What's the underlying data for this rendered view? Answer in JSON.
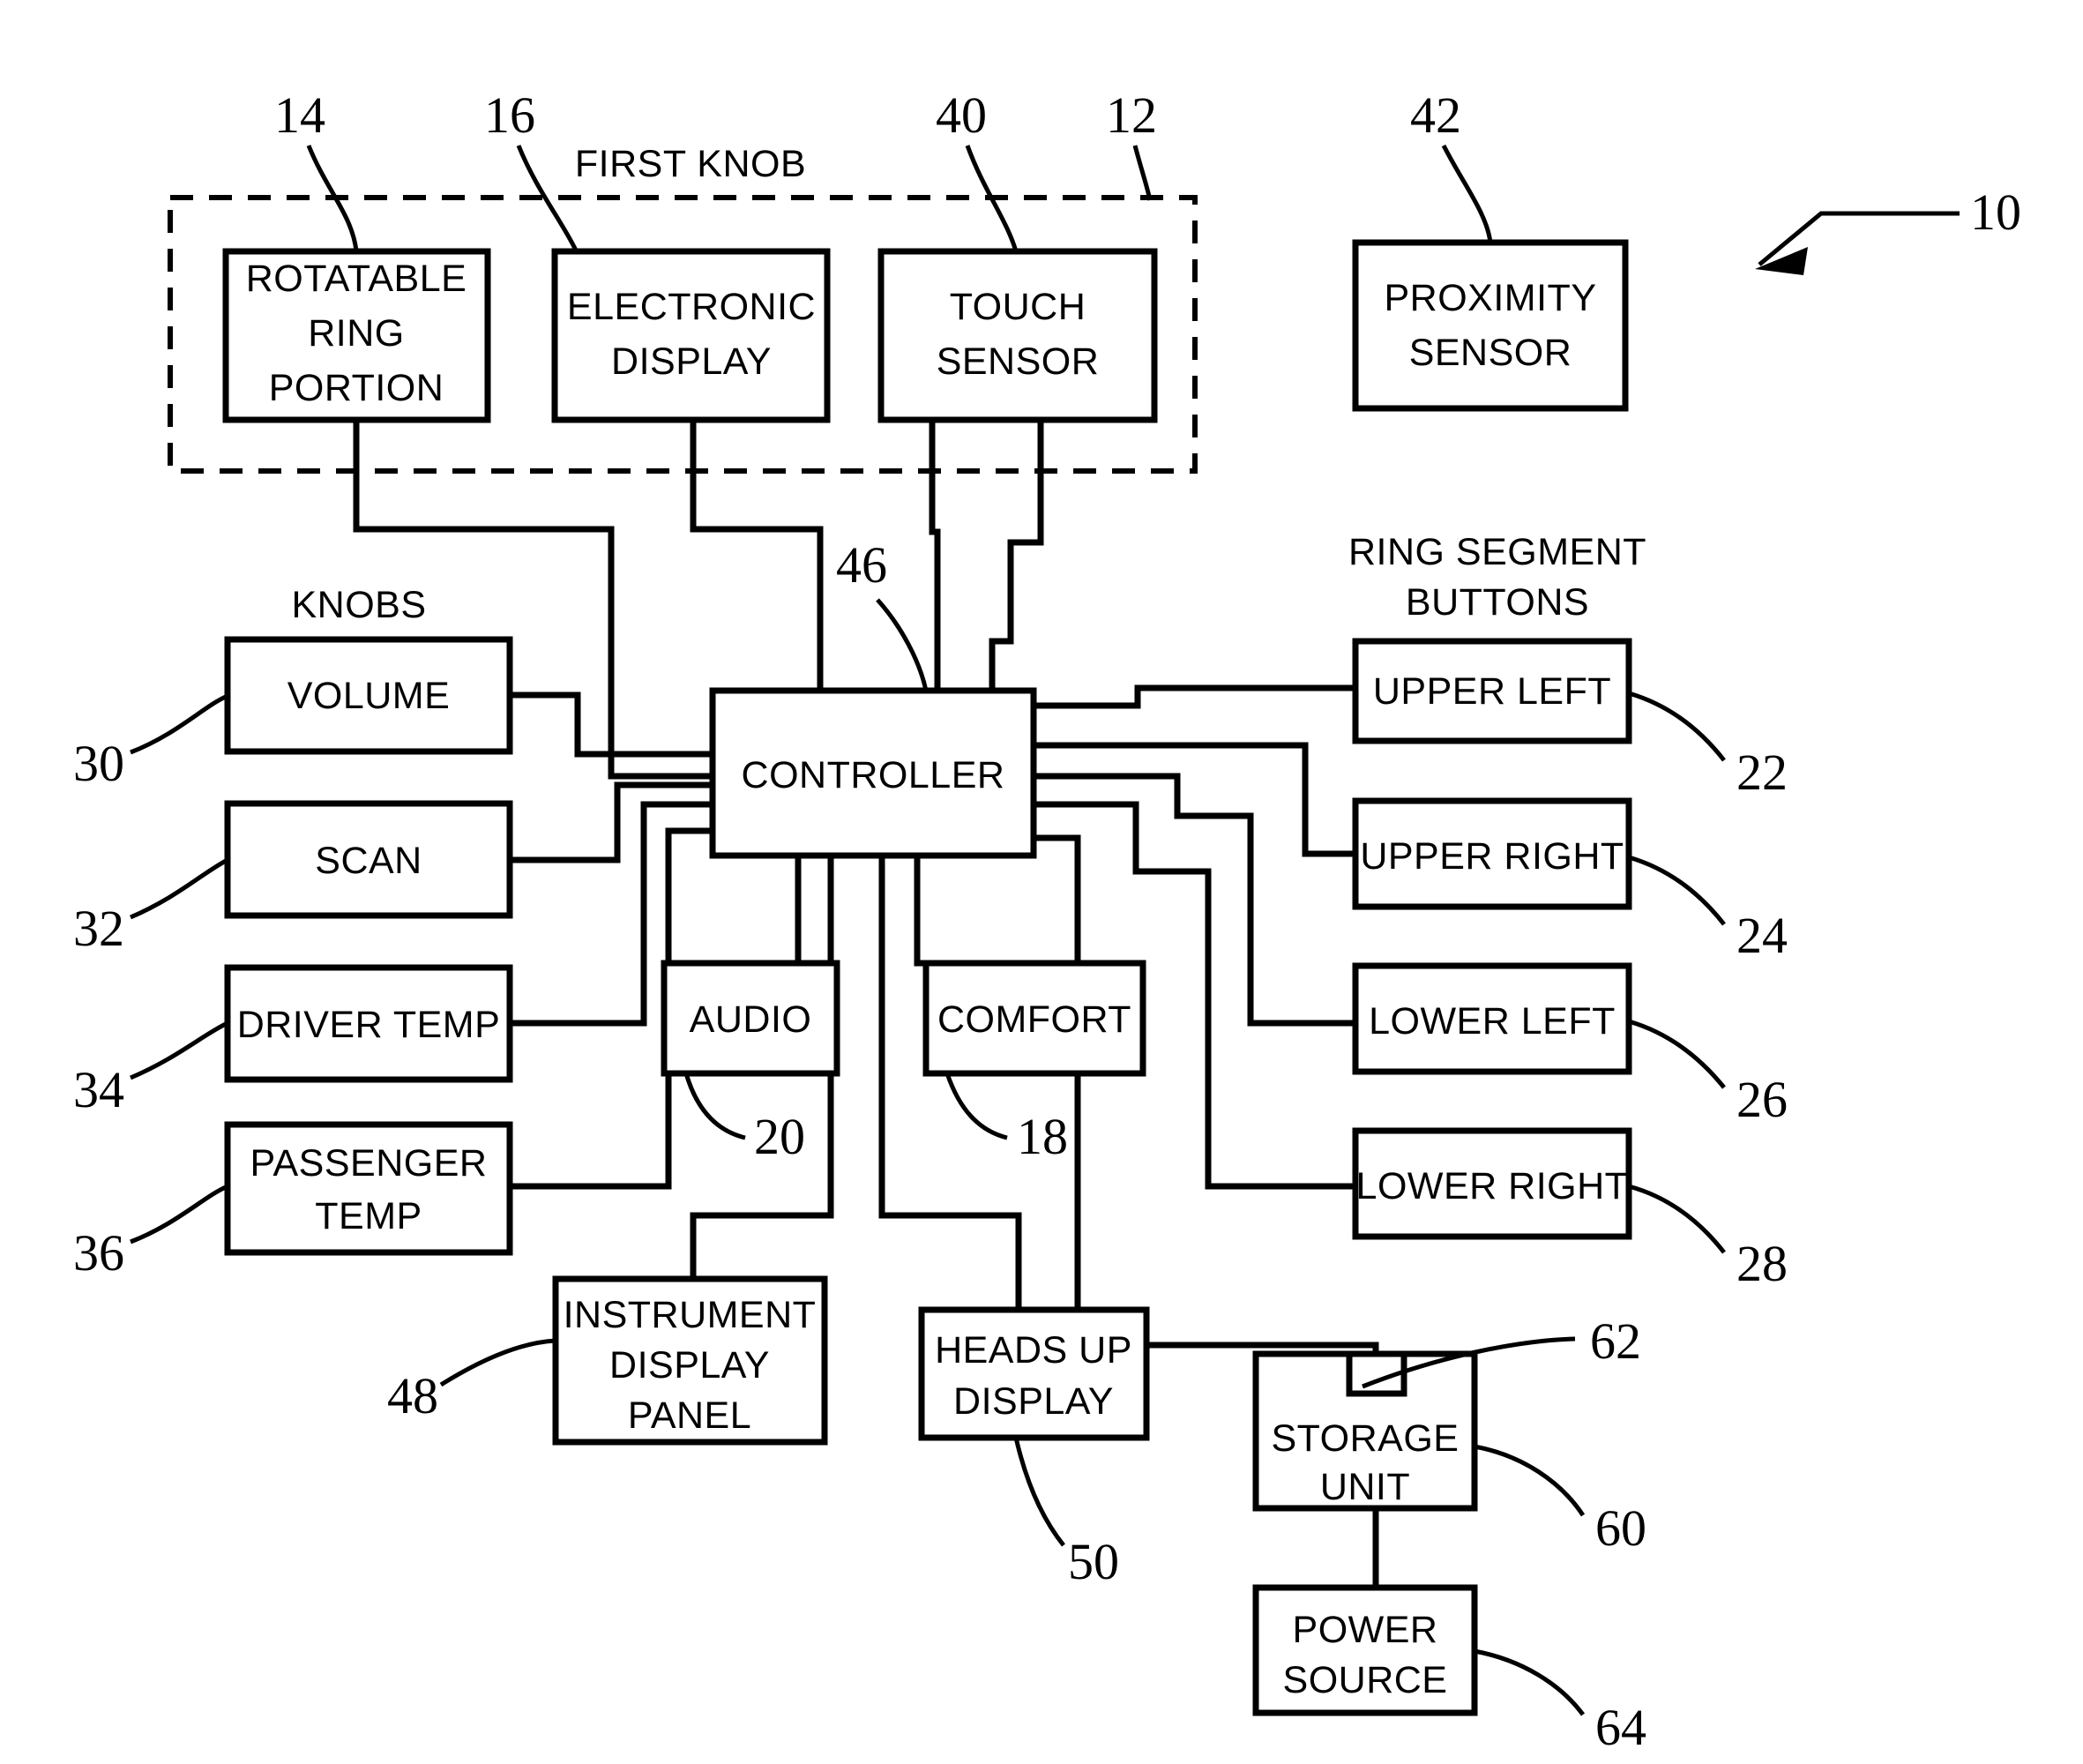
{
  "figure": {
    "title": "Vehicle control system block diagram",
    "system_ref": "10"
  },
  "group_labels": {
    "first_knob": "FIRST KNOB",
    "knobs": "KNOBS",
    "ring_segment_buttons_line1": "RING SEGMENT",
    "ring_segment_buttons_line2": "BUTTONS"
  },
  "blocks": [
    {
      "id": "rotatable-ring-portion",
      "lines": [
        "ROTATABLE",
        "RING",
        "PORTION"
      ],
      "ref": "14"
    },
    {
      "id": "electronic-display",
      "lines": [
        "ELECTRONIC",
        "DISPLAY"
      ],
      "ref": "16"
    },
    {
      "id": "touch-sensor",
      "lines": [
        "TOUCH",
        "SENSOR"
      ],
      "ref": "40"
    },
    {
      "id": "proximity-sensor",
      "lines": [
        "PROXIMITY",
        "SENSOR"
      ],
      "ref": "42"
    },
    {
      "id": "controller",
      "lines": [
        "CONTROLLER"
      ],
      "ref": "46"
    },
    {
      "id": "volume",
      "lines": [
        "VOLUME"
      ],
      "ref": "30"
    },
    {
      "id": "scan",
      "lines": [
        "SCAN"
      ],
      "ref": "32"
    },
    {
      "id": "driver-temp",
      "lines": [
        "DRIVER TEMP"
      ],
      "ref": "34"
    },
    {
      "id": "passenger-temp",
      "lines": [
        "PASSENGER",
        "TEMP"
      ],
      "ref": "36"
    },
    {
      "id": "audio",
      "lines": [
        "AUDIO"
      ],
      "ref": "20"
    },
    {
      "id": "comfort",
      "lines": [
        "COMFORT"
      ],
      "ref": "18"
    },
    {
      "id": "upper-left",
      "lines": [
        "UPPER LEFT"
      ],
      "ref": "22"
    },
    {
      "id": "upper-right",
      "lines": [
        "UPPER RIGHT"
      ],
      "ref": "24"
    },
    {
      "id": "lower-left",
      "lines": [
        "LOWER LEFT"
      ],
      "ref": "26"
    },
    {
      "id": "lower-right",
      "lines": [
        "LOWER RIGHT"
      ],
      "ref": "28"
    },
    {
      "id": "instrument-display-panel",
      "lines": [
        "INSTRUMENT",
        "DISPLAY",
        "PANEL"
      ],
      "ref": "48"
    },
    {
      "id": "heads-up-display",
      "lines": [
        "HEADS UP",
        "DISPLAY"
      ],
      "ref": "50"
    },
    {
      "id": "storage-unit",
      "lines": [
        "STORAGE",
        "UNIT"
      ],
      "ref": "60"
    },
    {
      "id": "storage-notch",
      "lines": [],
      "ref": "62"
    },
    {
      "id": "power-source",
      "lines": [
        "POWER",
        "SOURCE"
      ],
      "ref": "64"
    }
  ],
  "text": {
    "rotatable_ring_l1": "ROTATABLE",
    "rotatable_ring_l2": "RING",
    "rotatable_ring_l3": "PORTION",
    "electronic_display_l1": "ELECTRONIC",
    "electronic_display_l2": "DISPLAY",
    "touch_sensor_l1": "TOUCH",
    "touch_sensor_l2": "SENSOR",
    "proximity_sensor_l1": "PROXIMITY",
    "proximity_sensor_l2": "SENSOR",
    "controller": "CONTROLLER",
    "volume": "VOLUME",
    "scan": "SCAN",
    "driver_temp": "DRIVER TEMP",
    "passenger_temp_l1": "PASSENGER",
    "passenger_temp_l2": "TEMP",
    "audio": "AUDIO",
    "comfort": "COMFORT",
    "upper_left": "UPPER LEFT",
    "upper_right": "UPPER RIGHT",
    "lower_left": "LOWER LEFT",
    "lower_right": "LOWER RIGHT",
    "instrument_l1": "INSTRUMENT",
    "instrument_l2": "DISPLAY",
    "instrument_l3": "PANEL",
    "heads_up_l1": "HEADS UP",
    "heads_up_l2": "DISPLAY",
    "storage_l1": "STORAGE",
    "storage_l2": "UNIT",
    "power_l1": "POWER",
    "power_l2": "SOURCE"
  },
  "reference_numerals": {
    "n10": "10",
    "n12": "12",
    "n14": "14",
    "n16": "16",
    "n18": "18",
    "n20": "20",
    "n22": "22",
    "n24": "24",
    "n26": "26",
    "n28": "28",
    "n30": "30",
    "n32": "32",
    "n34": "34",
    "n36": "36",
    "n40": "40",
    "n42": "42",
    "n46": "46",
    "n48": "48",
    "n50": "50",
    "n60": "60",
    "n62": "62",
    "n64": "64"
  },
  "colors": {
    "ink": "#000000",
    "paper": "#ffffff"
  }
}
